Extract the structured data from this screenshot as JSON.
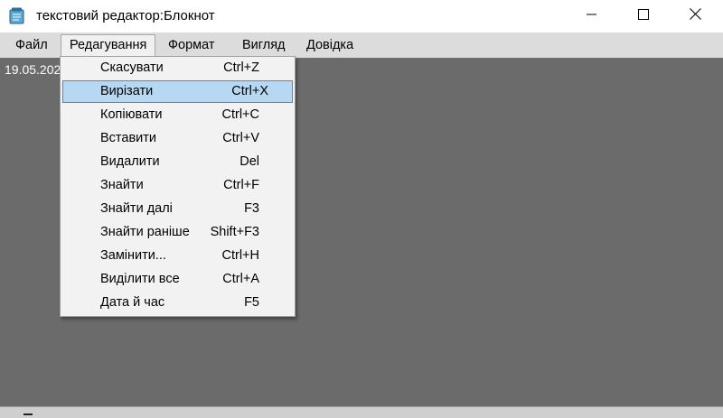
{
  "window": {
    "title": "текстовий редактор:Блокнот",
    "icon": "notepad-icon",
    "controls": [
      "minimize-icon",
      "maximize-icon",
      "close-icon"
    ]
  },
  "menubar": {
    "items": [
      {
        "label": "Файл"
      },
      {
        "label": "Редагування",
        "active": true
      },
      {
        "label": "Формат"
      },
      {
        "label": "Вигляд"
      },
      {
        "label": "Довідка"
      }
    ]
  },
  "editor": {
    "text": "19.05.202"
  },
  "edit_menu": {
    "items": [
      {
        "label": "Скасувати",
        "shortcut": "Ctrl+Z"
      },
      {
        "label": "Вирізати",
        "shortcut": "Ctrl+X",
        "highlighted": true
      },
      {
        "label": "Копіювати",
        "shortcut": "Ctrl+C"
      },
      {
        "label": "Вставити",
        "shortcut": "Ctrl+V"
      },
      {
        "label": "Видалити",
        "shortcut": "Del"
      },
      {
        "label": "Знайти",
        "shortcut": "Ctrl+F"
      },
      {
        "label": "Знайти далі",
        "shortcut": "F3"
      },
      {
        "label": "Знайти раніше",
        "shortcut": "Shift+F3"
      },
      {
        "label": "Замінити...",
        "shortcut": "Ctrl+H"
      },
      {
        "label": "Виділити все",
        "shortcut": "Ctrl+A"
      },
      {
        "label": "Дата й час",
        "shortcut": "F5"
      }
    ]
  },
  "colors": {
    "menubar_bg": "#dcdcdc",
    "editor_bg": "#6b6b6b",
    "menu_bg": "#f2f2f2",
    "highlight_bg": "#b7d8f2",
    "highlight_border": "#3e8ed3"
  }
}
